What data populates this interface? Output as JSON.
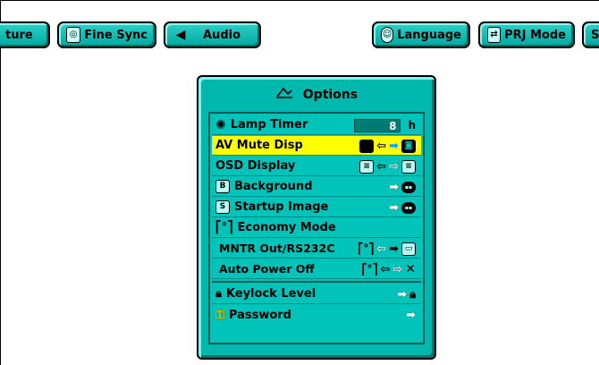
{
  "tabs": {
    "picture": {
      "label": "ture",
      "icon": "picture-icon"
    },
    "fine_sync": {
      "label": "Fine Sync",
      "icon": "fine-sync-icon"
    },
    "audio": {
      "label": "Audio",
      "icon": "speaker-icon"
    },
    "language": {
      "label": "Language",
      "icon": "speech-bubble-icon"
    },
    "prj_mode": {
      "label": "PRJ Mode",
      "icon": "prj-mode-icon"
    },
    "s": {
      "label": "S",
      "icon": ""
    }
  },
  "options": {
    "title": "Options",
    "title_icon": "options-icon",
    "rows": {
      "lamp_timer": {
        "label": "Lamp Timer",
        "value": "8",
        "unit": "h",
        "icon": "lamp-icon"
      },
      "av_mute_disp": {
        "label": "AV Mute Disp",
        "selected": true
      },
      "osd_display": {
        "label": "OSD Display"
      },
      "background": {
        "label": "Background",
        "icon_letter": "B"
      },
      "startup_image": {
        "label": "Startup Image",
        "icon_letter": "S"
      },
      "economy_mode": {
        "label": "Economy Mode",
        "icon": "economy-mode-icon"
      },
      "mntr_out": {
        "label": "MNTR Out/RS232C"
      },
      "auto_power_off": {
        "label": "Auto Power Off"
      },
      "keylock_level": {
        "label": "Keylock Level",
        "icon": "lock-icon"
      },
      "password": {
        "label": "Password",
        "icon": "key-icon"
      }
    }
  },
  "colors": {
    "panel": "#00b8ae",
    "tab": "#00a8a0",
    "highlight": "#ffff00"
  }
}
